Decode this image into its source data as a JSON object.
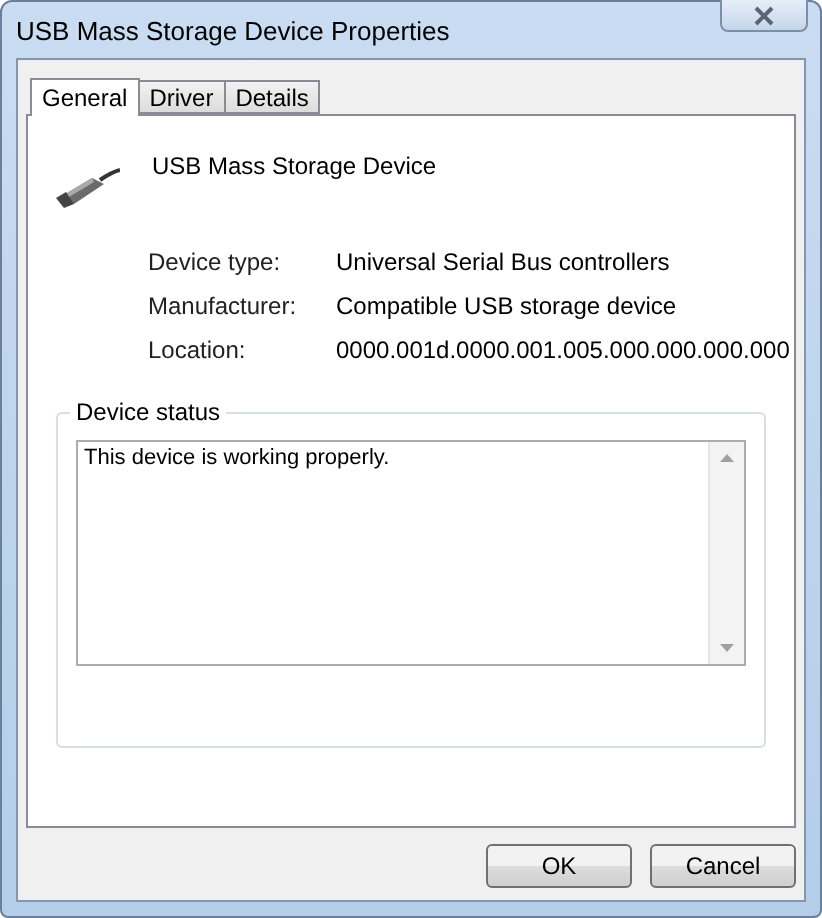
{
  "window": {
    "title": "USB Mass Storage Device Properties"
  },
  "tabs": [
    {
      "label": "General",
      "selected": true
    },
    {
      "label": "Driver",
      "selected": false
    },
    {
      "label": "Details",
      "selected": false
    }
  ],
  "device": {
    "name": "USB Mass Storage Device"
  },
  "properties": [
    {
      "label": "Device type:",
      "value": "Universal Serial Bus controllers"
    },
    {
      "label": "Manufacturer:",
      "value": "Compatible USB storage device"
    },
    {
      "label": "Location:",
      "value": "0000.001d.0000.001.005.000.000.000.000"
    }
  ],
  "device_status": {
    "title": "Device status",
    "text": "This device is working properly."
  },
  "buttons": [
    {
      "label": "OK"
    },
    {
      "label": "Cancel"
    }
  ]
}
